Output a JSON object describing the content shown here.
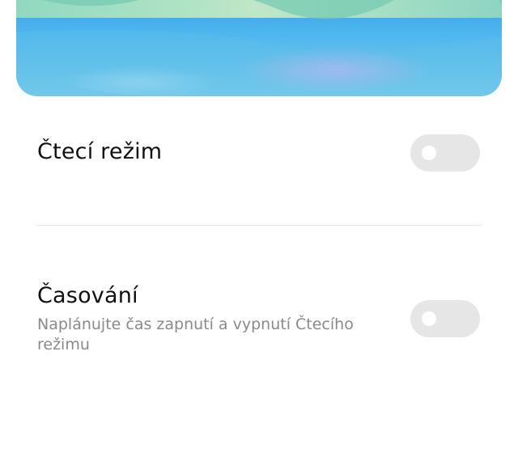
{
  "preview": {
    "icon": "wallpaper-preview-image"
  },
  "settings": [
    {
      "title": "Čtecí režim",
      "subtitle": "",
      "enabled": false
    },
    {
      "title": "Časování",
      "subtitle": "Naplánujte čas zapnutí a vypnutí Čtecího režimu",
      "enabled": false
    }
  ],
  "colors": {
    "toggle_off_track": "#e6e6e6",
    "toggle_knob": "#ffffff",
    "title_text": "#111111",
    "subtitle_text": "#8a8a8a",
    "divider": "#e4e4e4"
  }
}
